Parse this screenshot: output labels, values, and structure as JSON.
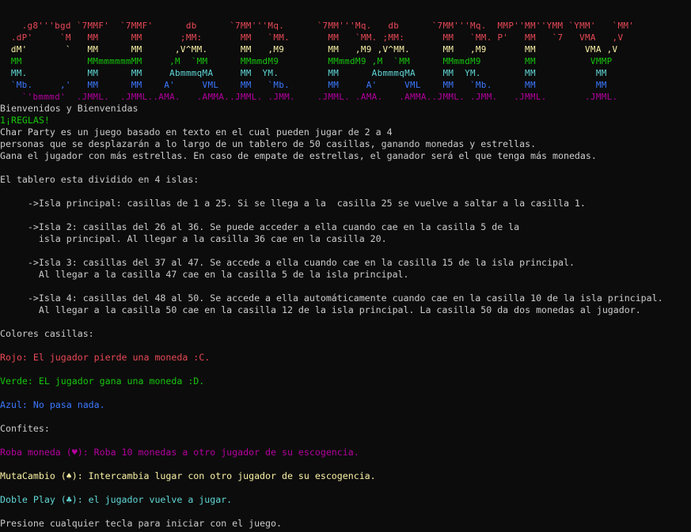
{
  "colors": {
    "background": "#0c0c0c",
    "text": "#cccccc",
    "red": "#e74856",
    "green": "#16c60c",
    "blue": "#3b78ff",
    "magenta": "#b4009e",
    "yellow": "#f9f1a5",
    "cyan": "#61d6d6"
  },
  "banner": {
    "lines": [
      "    .g8'''bgd `7MMF'  `7MMF'      db      `7MM'''Mq.      `7MM'''Mq.   db      `7MM'''Mq.  MMP''MM''YMM `YMM'   `MM'",
      "  .dP'     `M   MM      MM       ;MM:       MM   `MM.       MM   `MM. ;MM:       MM   `MM. P'   MM   `7   VMA   ,V",
      "  dM'       `   MM      MM      ,V^MM.      MM   ,M9        MM   ,M9 ,V^MM.      MM   ,M9       MM         VMA ,V",
      "  MM            MMmmmmmmMM     ,M  `MM      MMmmdM9         MMmmdM9 ,M  `MM      MMmmdM9        MM          VMMP",
      "  MM.           MM      MM     AbmmmqMA     MM  YM.         MM      AbmmmqMA     MM  YM.        MM           MM",
      "  `Mb.     ,'   MM      MM    A'     VML    MM   `Mb.       MM     A'     VML    MM   `Mb.      MM           MM",
      "    `'bmmmd'  .JMML.  .JMML..AMA.   .AMMA..JMML. .JMM.    .JMML. .AMA.   .AMMA..JMML. .JMM.   .JMML.       .JMML."
    ]
  },
  "welcome": "Bienvenidos y Bienvenidas",
  "rules_heading": "1¡REGLAS!",
  "intro": [
    "Char Party es un juego basado en texto en el cual pueden jugar de 2 a 4",
    "personas que se desplazarán a lo largo de un tablero de 50 casillas, ganando monedas y estrellas.",
    "Gana el jugador con más estrellas. En caso de empate de estrellas, el ganador será el que tenga más monedas."
  ],
  "board_intro": "El tablero esta dividido en 4 islas:",
  "islands": [
    "     ->Isla principal: casillas de 1 a 25. Si se llega a la  casilla 25 se vuelve a saltar a la casilla 1.",
    "     ->Isla 2: casillas del 26 al 36. Se puede acceder a ella cuando cae en la casilla 5 de la",
    "       isla principal. Al llegar a la casilla 36 cae en la casilla 20.",
    "     ->Isla 3: casillas del 37 al 47. Se accede a ella cuando cae en la casilla 15 de la isla principal.",
    "       Al llegar a la casilla 47 cae en la casilla 5 de la isla principal.",
    "     ->Isla 4: casillas del 48 al 50. Se accede a ella automáticamente cuando cae en la casilla 10 de la isla principal.",
    "       Al llegar a la casilla 50 cae en la casilla 12 de la isla principal. La casilla 50 da dos monedas al jugador."
  ],
  "colors_heading": "Colores casillas:",
  "tile_colors": {
    "red": "Rojo: El jugador pierde una moneda :C.",
    "green": "Verde: EL jugador gana una moneda :D.",
    "blue": "Azul: No pasa nada."
  },
  "confites_heading": "Confites:",
  "confites": {
    "roba": "Roba moneda (♥): Roba 10 monedas a otro jugador de su escogencia.",
    "muta": "MutaCambio (♠): Intercambia lugar con otro jugador de su escogencia.",
    "doble": "Doble Play (♣): el jugador vuelve a jugar."
  },
  "prompt": "Presione cualquier tecla para iniciar con el juego."
}
